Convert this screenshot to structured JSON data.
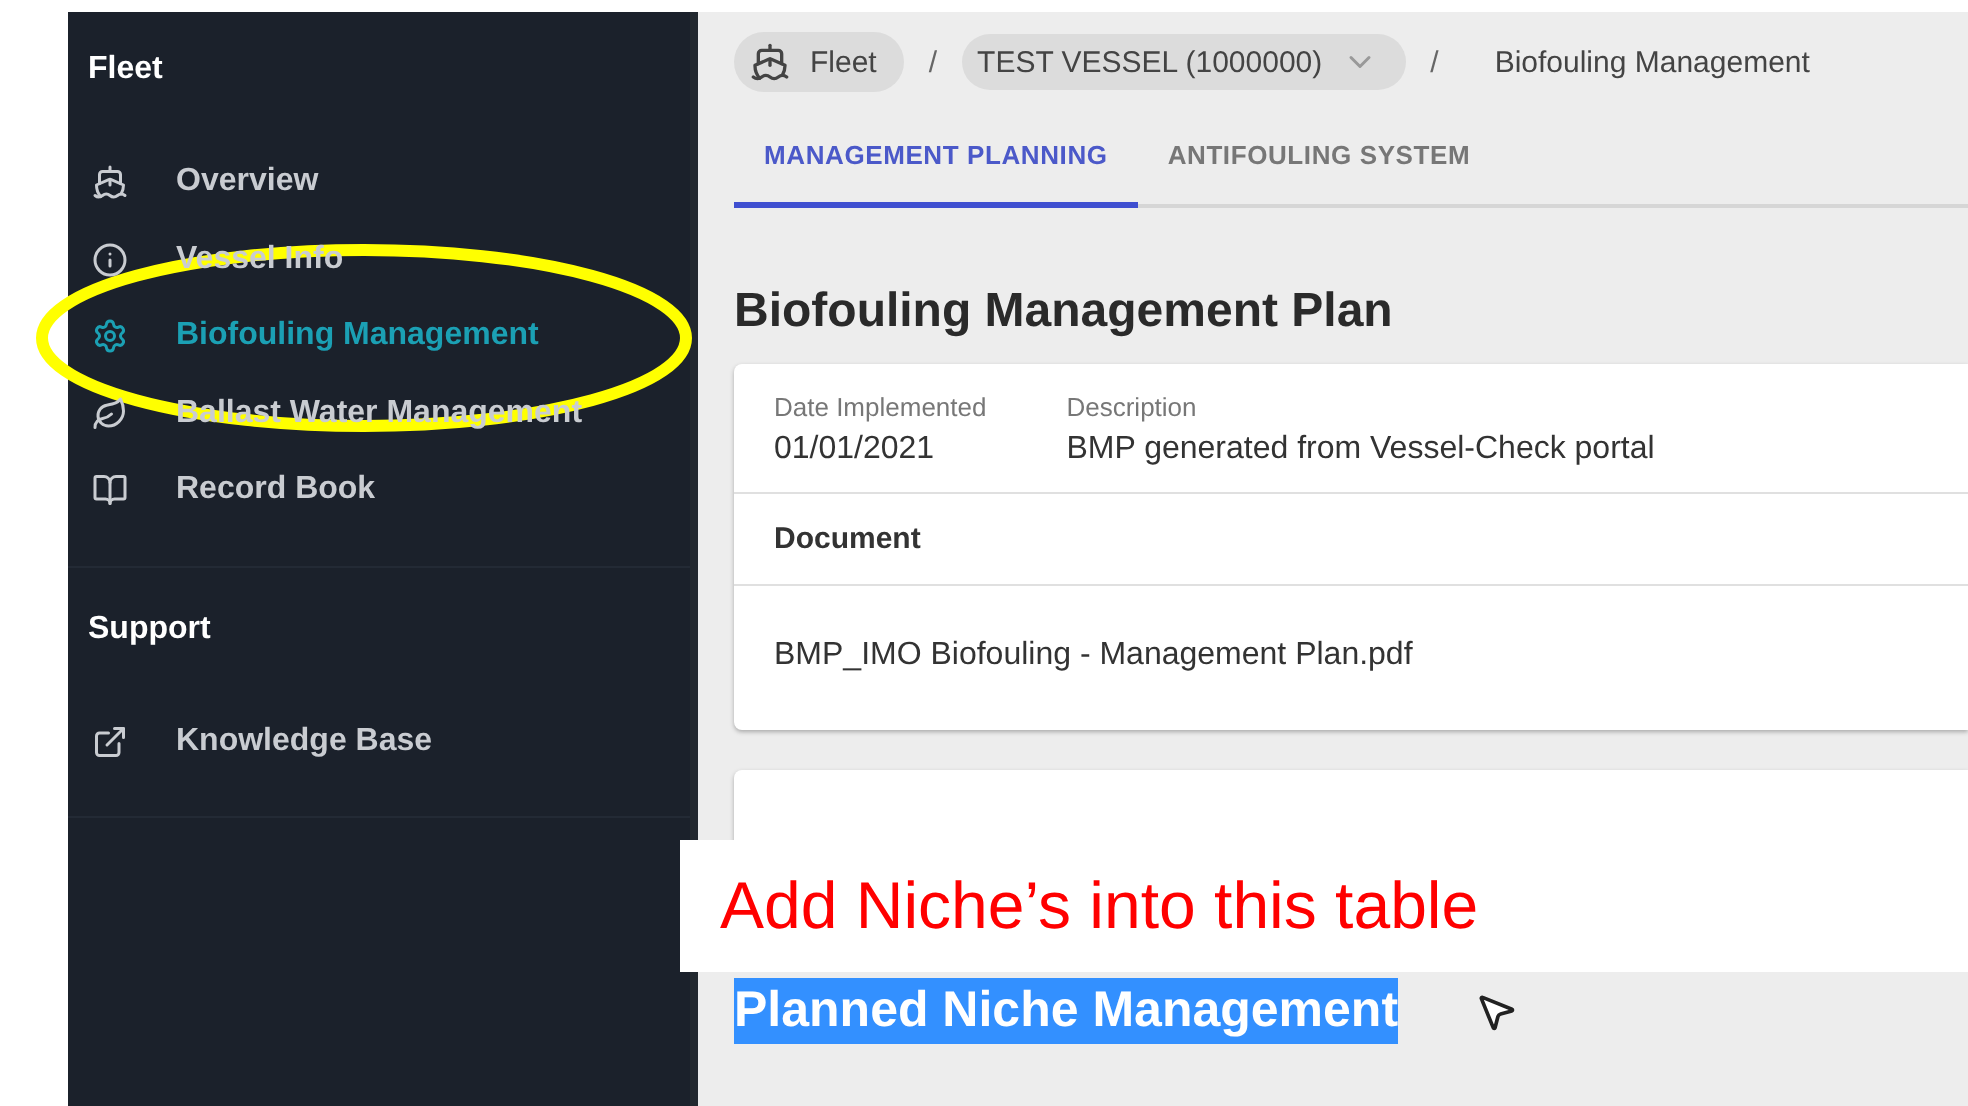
{
  "sidebar": {
    "sections": [
      {
        "title": "Fleet",
        "items": [
          {
            "label": "Overview",
            "selected": false
          },
          {
            "label": "Vessel Info",
            "selected": false
          },
          {
            "label": "Biofouling Management",
            "selected": true
          },
          {
            "label": "Ballast Water Management",
            "selected": false
          },
          {
            "label": "Record Book",
            "selected": false
          }
        ]
      },
      {
        "title": "Support",
        "items": [
          {
            "label": "Knowledge Base",
            "selected": false
          }
        ]
      }
    ]
  },
  "breadcrumb": [
    {
      "label": "Fleet",
      "kind": "chip-icon"
    },
    {
      "separator": "/",
      "label": "TEST VESSEL (1000000)",
      "kind": "chip-dropdown"
    },
    {
      "separator": "/",
      "label": "Biofouling Management",
      "kind": "text"
    }
  ],
  "tabs": [
    {
      "label": "MANAGEMENT PLANNING",
      "selected": true
    },
    {
      "label": "ANTIFOULING SYSTEM",
      "selected": false
    }
  ],
  "page_title": "Biofouling Management Plan",
  "plan_card": {
    "fields": [
      {
        "label": "Date Implemented",
        "value": "01/01/2021"
      },
      {
        "label": "Description",
        "value": "BMP generated from Vessel-Check portal"
      }
    ],
    "document_header": "Document",
    "document": "BMP_IMO Biofouling - Management Plan.pdf"
  },
  "annotation": {
    "note": "Add Niche’s into this table"
  },
  "section_heading": {
    "text": "Planned Niche Management",
    "selected": true
  }
}
